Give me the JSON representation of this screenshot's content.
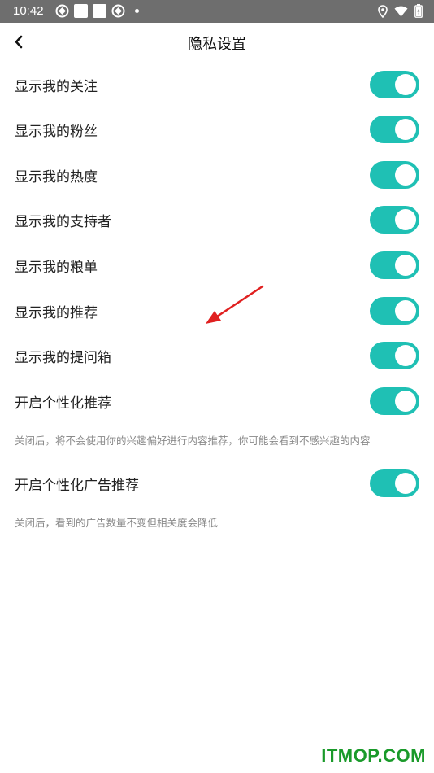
{
  "status_bar": {
    "time": "10:42"
  },
  "header": {
    "title": "隐私设置"
  },
  "settings": [
    {
      "label": "显示我的关注",
      "enabled": true
    },
    {
      "label": "显示我的粉丝",
      "enabled": true
    },
    {
      "label": "显示我的热度",
      "enabled": true
    },
    {
      "label": "显示我的支持者",
      "enabled": true
    },
    {
      "label": "显示我的粮单",
      "enabled": true
    },
    {
      "label": "显示我的推荐",
      "enabled": true
    },
    {
      "label": "显示我的提问箱",
      "enabled": true
    },
    {
      "label": "开启个性化推荐",
      "enabled": true,
      "note": "关闭后，将不会使用你的兴趣偏好进行内容推荐，你可能会看到不感兴趣的内容"
    },
    {
      "label": "开启个性化广告推荐",
      "enabled": true,
      "note": "关闭后，看到的广告数量不变但相关度会降低"
    }
  ],
  "colors": {
    "toggle_on": "#1fc0b4",
    "status_bar": "#6e6e6e",
    "arrow": "#e02020",
    "watermark": "#1a9a2a"
  },
  "watermark": "ITMOP.COM"
}
